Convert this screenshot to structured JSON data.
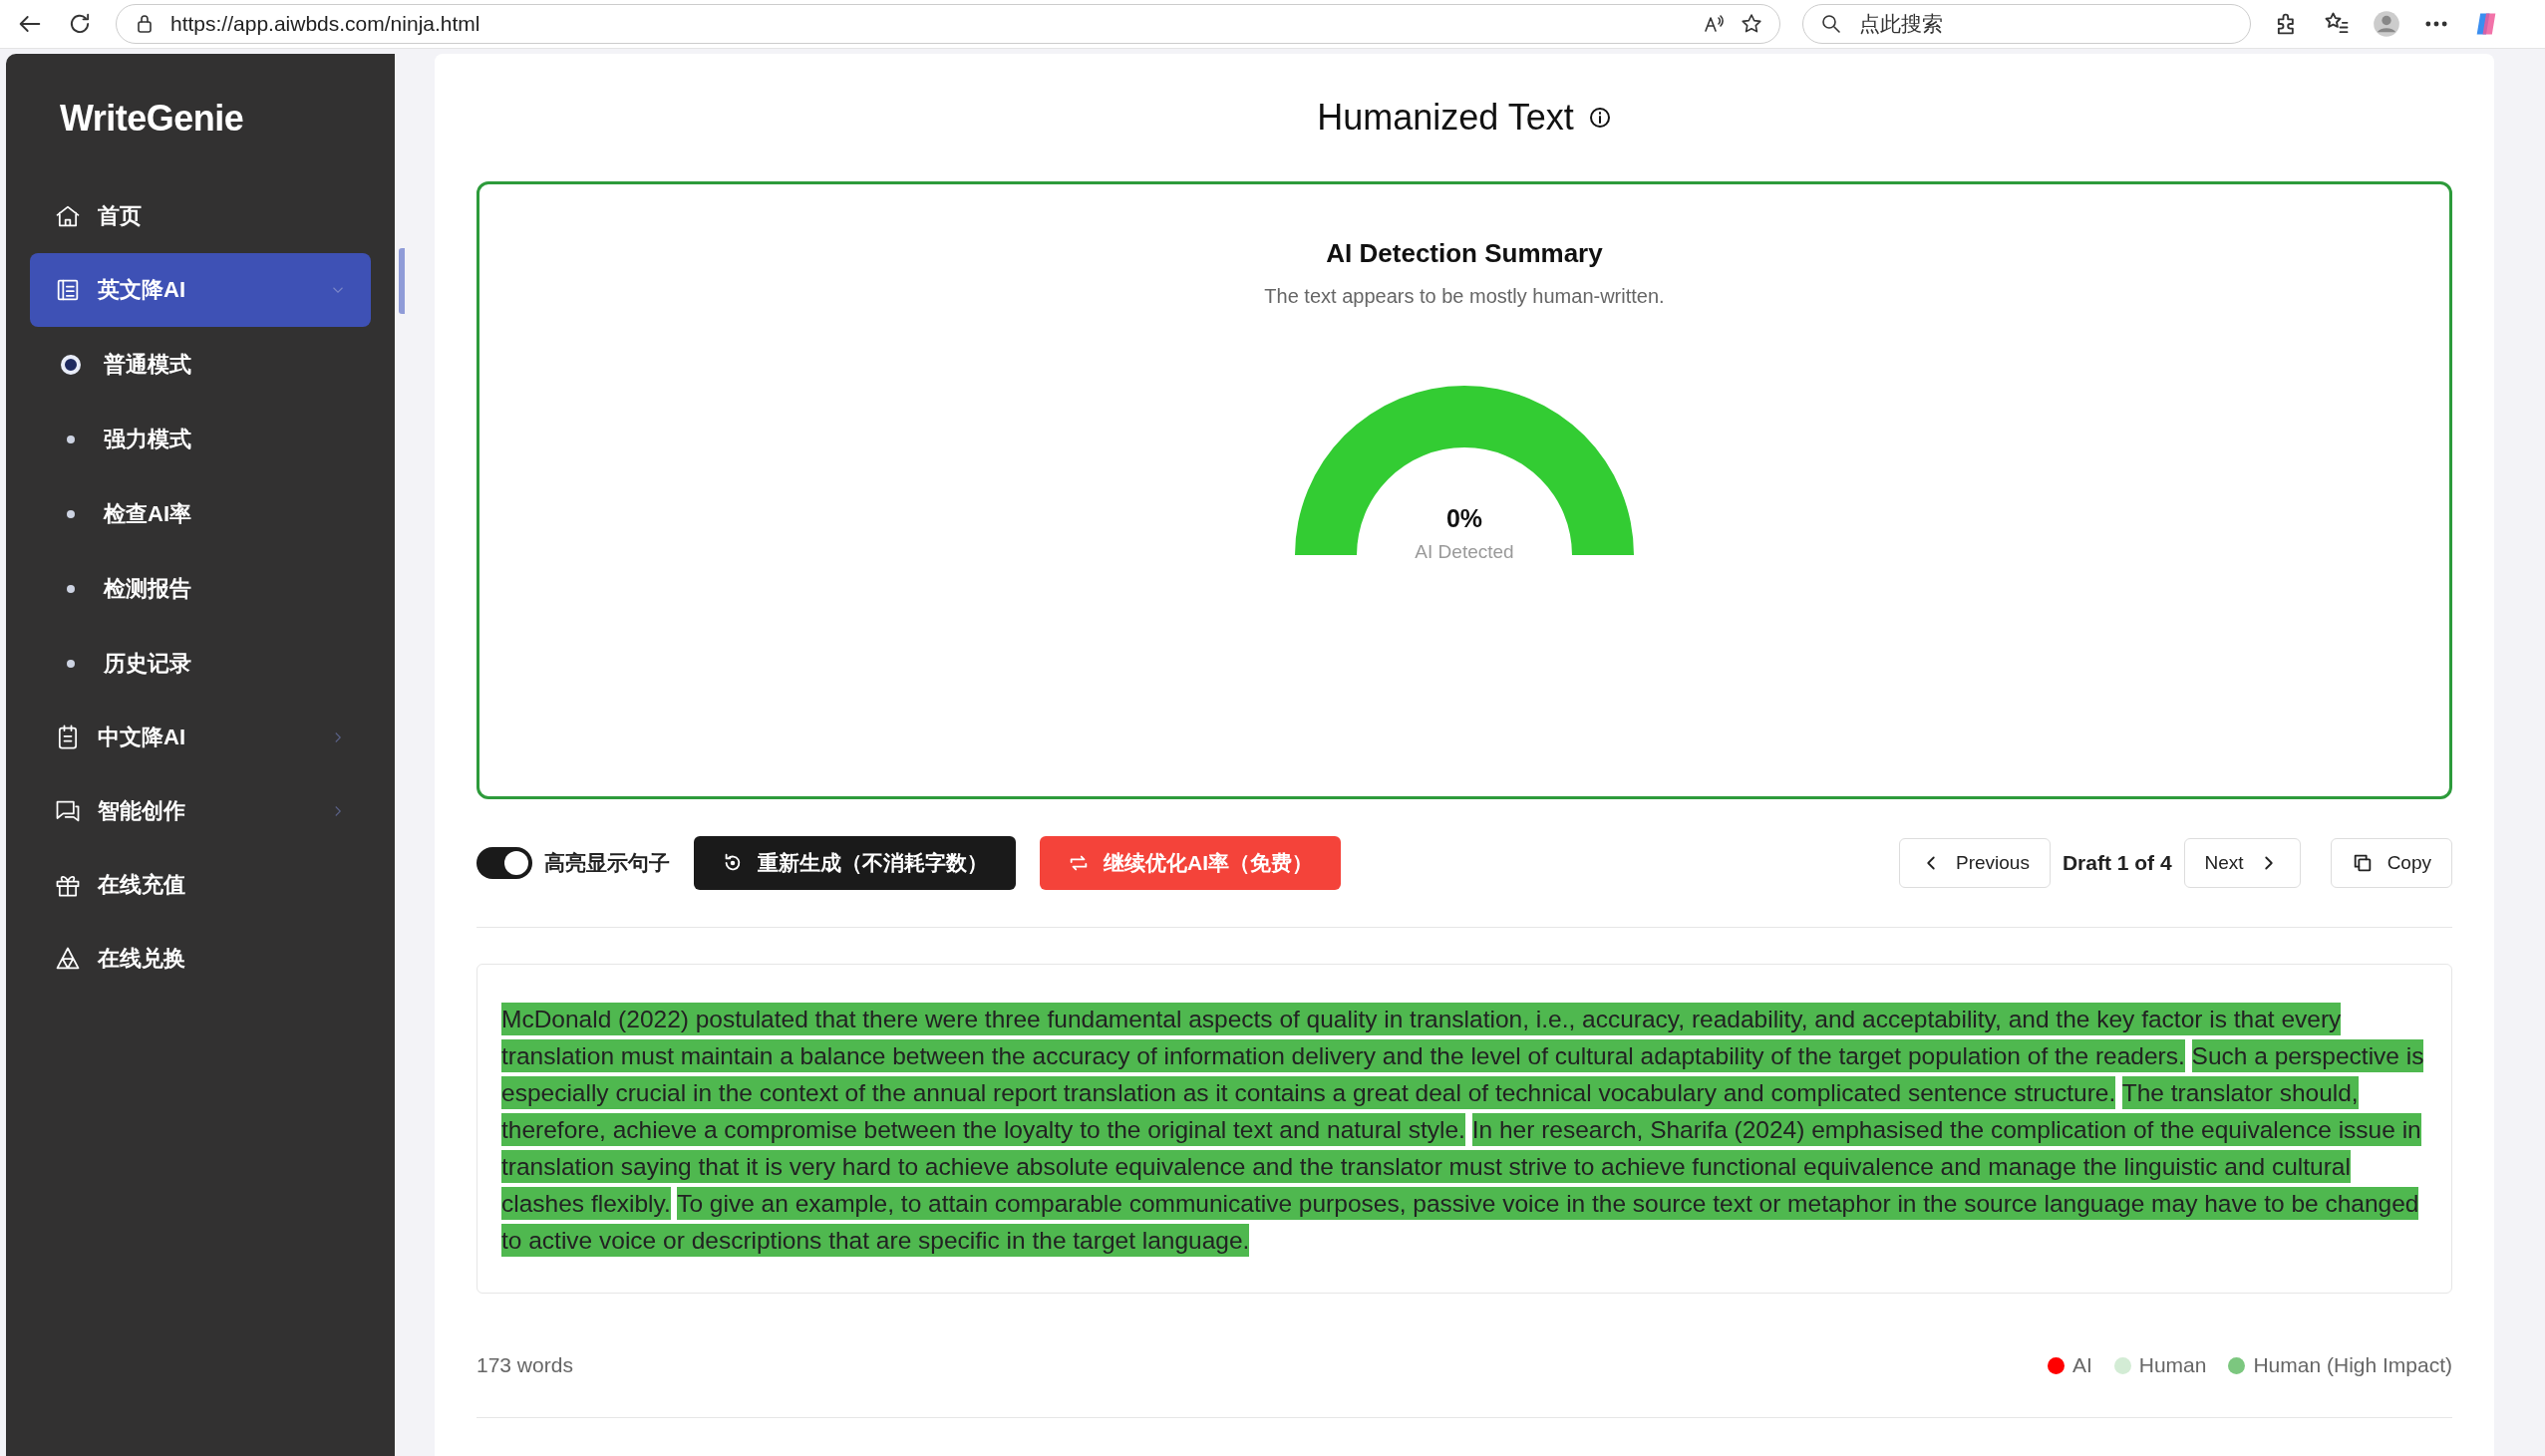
{
  "browser": {
    "url": "https://app.aiwbds.com/ninja.html",
    "search_placeholder": "点此搜索"
  },
  "sidebar": {
    "brand": "WriteGenie",
    "items": [
      {
        "label": "首页",
        "selected": false
      },
      {
        "label": "英文降AI",
        "selected": true,
        "expanded": true,
        "children": [
          {
            "label": "普通模式",
            "selected": true
          },
          {
            "label": "强力模式",
            "selected": false
          },
          {
            "label": "检查AI率",
            "selected": false
          },
          {
            "label": "检测报告",
            "selected": false
          },
          {
            "label": "历史记录",
            "selected": false
          }
        ]
      },
      {
        "label": "中文降AI",
        "selected": false,
        "expanded": false
      },
      {
        "label": "智能创作",
        "selected": false,
        "expanded": false
      },
      {
        "label": "在线充值",
        "selected": false
      },
      {
        "label": "在线兑换",
        "selected": false
      }
    ]
  },
  "main": {
    "title": "Humanized Text",
    "summary": {
      "heading": "AI Detection Summary",
      "subtitle": "The text appears to be mostly human-written.",
      "gauge": {
        "value": "0%",
        "label": "AI Detected"
      }
    },
    "toolbar": {
      "highlight_toggle": {
        "label": "高亮显示句子",
        "on": true
      },
      "regenerate_button": "重新生成（不消耗字数）",
      "optimize_button": "继续优化AI率（免费）",
      "previous_button": "Previous",
      "draft": "Draft 1 of 4",
      "next_button": "Next",
      "copy_button": "Copy"
    },
    "sentences": [
      {
        "text": "McDonald (2022) postulated that there were three fundamental aspects of quality in translation, i.e., accuracy, readability, and acceptability, and the key factor is that every translation must maintain a balance between the accuracy of information delivery and the level of cultural adaptability of the target population of the readers.",
        "kind": "human_high"
      },
      {
        "text": "Such a perspective is especially crucial in the context of the annual report translation as it contains a great deal of technical vocabulary and complicated sentence structure.",
        "kind": "human_high"
      },
      {
        "text": "The translator should, therefore, achieve a compromise between the loyalty to the original text and natural style.",
        "kind": "human_high"
      },
      {
        "text": "In her research, Sharifa (2024) emphasised the complication of the equivalence issue in translation saying that it is very hard to achieve absolute equivalence and the translator must strive to achieve functional equivalence and manage the linguistic and cultural clashes flexibly.",
        "kind": "human_high"
      },
      {
        "text": "To give an example, to attain comparable communicative purposes, passive voice in the source text or metaphor in the source language may have to be changed to active voice or descriptions that are specific in the target language.",
        "kind": "human_high"
      }
    ],
    "word_count": "173 words",
    "legend": [
      {
        "label": "AI",
        "color": "#ff0000"
      },
      {
        "label": "Human",
        "color": "#d3ecd5"
      },
      {
        "label": "Human (High Impact)",
        "color": "#7cc77f"
      }
    ]
  }
}
